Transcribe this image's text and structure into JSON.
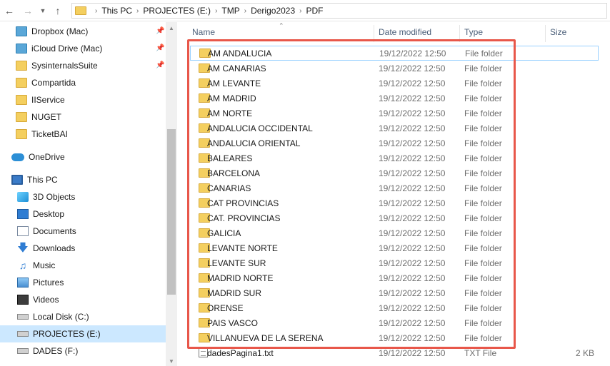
{
  "breadcrumb": [
    "This PC",
    "PROJECTES (E:)",
    "TMP",
    "Derigo2023",
    "PDF"
  ],
  "nav": {
    "quick_access": [
      {
        "label": "Dropbox (Mac)",
        "icon": "sync-folder-icon",
        "pinned": true
      },
      {
        "label": "iCloud Drive (Mac)",
        "icon": "sync-folder-icon",
        "pinned": true
      },
      {
        "label": "SysinternalsSuite",
        "icon": "folder-icon",
        "pinned": true
      },
      {
        "label": "Compartida",
        "icon": "folder-icon",
        "pinned": false
      },
      {
        "label": "IIService",
        "icon": "folder-icon",
        "pinned": false
      },
      {
        "label": "NUGET",
        "icon": "folder-icon",
        "pinned": false
      },
      {
        "label": "TicketBAI",
        "icon": "folder-icon",
        "pinned": false
      }
    ],
    "onedrive": "OneDrive",
    "this_pc": "This PC",
    "pc_items": [
      {
        "label": "3D Objects",
        "icon": "cube-icon"
      },
      {
        "label": "Desktop",
        "icon": "desktop-icon"
      },
      {
        "label": "Documents",
        "icon": "document-icon"
      },
      {
        "label": "Downloads",
        "icon": "download-icon"
      },
      {
        "label": "Music",
        "icon": "music-icon"
      },
      {
        "label": "Pictures",
        "icon": "picture-icon"
      },
      {
        "label": "Videos",
        "icon": "video-icon"
      },
      {
        "label": "Local Disk (C:)",
        "icon": "disk-icon"
      },
      {
        "label": "PROJECTES (E:)",
        "icon": "disk-icon",
        "selected": true
      },
      {
        "label": "DADES (F:)",
        "icon": "disk-icon"
      }
    ]
  },
  "columns": {
    "name": "Name",
    "date": "Date modified",
    "type": "Type",
    "size": "Size"
  },
  "files": [
    {
      "name": "AM ANDALUCIA",
      "date": "19/12/2022 12:50",
      "type": "File folder",
      "size": "",
      "kind": "folder"
    },
    {
      "name": "AM CANARIAS",
      "date": "19/12/2022 12:50",
      "type": "File folder",
      "size": "",
      "kind": "folder"
    },
    {
      "name": "AM LEVANTE",
      "date": "19/12/2022 12:50",
      "type": "File folder",
      "size": "",
      "kind": "folder"
    },
    {
      "name": "AM MADRID",
      "date": "19/12/2022 12:50",
      "type": "File folder",
      "size": "",
      "kind": "folder"
    },
    {
      "name": "AM NORTE",
      "date": "19/12/2022 12:50",
      "type": "File folder",
      "size": "",
      "kind": "folder"
    },
    {
      "name": "ANDALUCIA OCCIDENTAL",
      "date": "19/12/2022 12:50",
      "type": "File folder",
      "size": "",
      "kind": "folder"
    },
    {
      "name": "ANDALUCIA ORIENTAL",
      "date": "19/12/2022 12:50",
      "type": "File folder",
      "size": "",
      "kind": "folder"
    },
    {
      "name": "BALEARES",
      "date": "19/12/2022 12:50",
      "type": "File folder",
      "size": "",
      "kind": "folder"
    },
    {
      "name": "BARCELONA",
      "date": "19/12/2022 12:50",
      "type": "File folder",
      "size": "",
      "kind": "folder"
    },
    {
      "name": "CANARIAS",
      "date": "19/12/2022 12:50",
      "type": "File folder",
      "size": "",
      "kind": "folder"
    },
    {
      "name": "CAT PROVINCIAS",
      "date": "19/12/2022 12:50",
      "type": "File folder",
      "size": "",
      "kind": "folder"
    },
    {
      "name": "CAT. PROVINCIAS",
      "date": "19/12/2022 12:50",
      "type": "File folder",
      "size": "",
      "kind": "folder"
    },
    {
      "name": "GALICIA",
      "date": "19/12/2022 12:50",
      "type": "File folder",
      "size": "",
      "kind": "folder"
    },
    {
      "name": "LEVANTE NORTE",
      "date": "19/12/2022 12:50",
      "type": "File folder",
      "size": "",
      "kind": "folder"
    },
    {
      "name": "LEVANTE SUR",
      "date": "19/12/2022 12:50",
      "type": "File folder",
      "size": "",
      "kind": "folder"
    },
    {
      "name": "MADRID NORTE",
      "date": "19/12/2022 12:50",
      "type": "File folder",
      "size": "",
      "kind": "folder"
    },
    {
      "name": "MADRID SUR",
      "date": "19/12/2022 12:50",
      "type": "File folder",
      "size": "",
      "kind": "folder"
    },
    {
      "name": "ORENSE",
      "date": "19/12/2022 12:50",
      "type": "File folder",
      "size": "",
      "kind": "folder"
    },
    {
      "name": "PAIS VASCO",
      "date": "19/12/2022 12:50",
      "type": "File folder",
      "size": "",
      "kind": "folder"
    },
    {
      "name": "VILLANUEVA DE LA SERENA",
      "date": "19/12/2022 12:50",
      "type": "File folder",
      "size": "",
      "kind": "folder"
    },
    {
      "name": "dadesPagina1.txt",
      "date": "19/12/2022 12:50",
      "type": "TXT File",
      "size": "2 KB",
      "kind": "txt"
    }
  ],
  "colors": {
    "highlight": "#e8574a",
    "selected": "#cce8ff",
    "folder": "#f4cf5f"
  }
}
